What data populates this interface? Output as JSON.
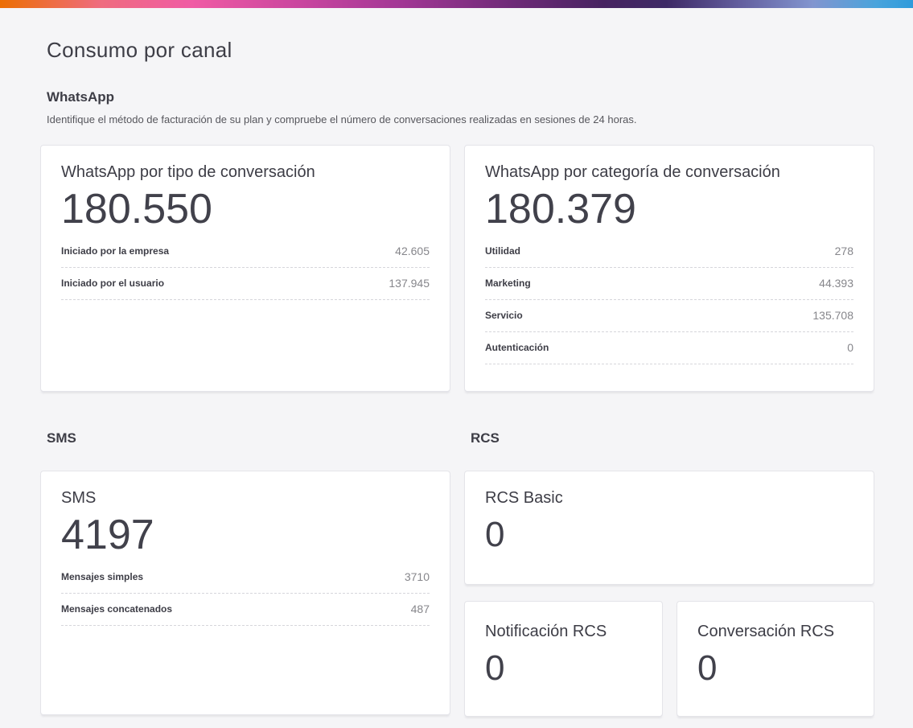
{
  "page_title": "Consumo por canal",
  "colors": {
    "gradient_start": "#EC6E03",
    "gradient_pink": "#F05BA4",
    "gradient_magenta": "#A23795",
    "gradient_dark_purple": "#472361",
    "gradient_periwinkle": "#8295CF",
    "gradient_end": "#2E9BDB",
    "heading_text": "#3D3D46",
    "number_text": "#41414B",
    "value_text": "#86868B",
    "description_text": "#56565C",
    "background": "#F5F5F7",
    "card_background": "#FFFFFF",
    "card_border": "#E4E4E9"
  },
  "whatsapp": {
    "heading": "WhatsApp",
    "description": "Identifique el método de facturación de su plan y compruebe el número de conversaciones realizadas en sesiones de 24 horas.",
    "type_card": {
      "title": "WhatsApp por tipo de conversación",
      "total": "180.550",
      "rows": [
        {
          "label": "Iniciado por la empresa",
          "value": "42.605"
        },
        {
          "label": "Iniciado por el usuario",
          "value": "137.945"
        }
      ]
    },
    "category_card": {
      "title": "WhatsApp por categoría de conversación",
      "total": "180.379",
      "rows": [
        {
          "label": "Utilidad",
          "value": "278"
        },
        {
          "label": "Marketing",
          "value": "44.393"
        },
        {
          "label": "Servicio",
          "value": "135.708"
        },
        {
          "label": "Autenticación",
          "value": "0"
        }
      ]
    }
  },
  "sms": {
    "heading": "SMS",
    "card": {
      "title": "SMS",
      "total": "4197",
      "rows": [
        {
          "label": "Mensajes simples",
          "value": "3710"
        },
        {
          "label": "Mensajes concatenados",
          "value": "487"
        }
      ]
    }
  },
  "rcs": {
    "heading": "RCS",
    "basic_card": {
      "title": "RCS Basic",
      "total": "0"
    },
    "notification_card": {
      "title": "Notificación RCS",
      "total": "0"
    },
    "conversation_card": {
      "title": "Conversación RCS",
      "total": "0"
    }
  }
}
